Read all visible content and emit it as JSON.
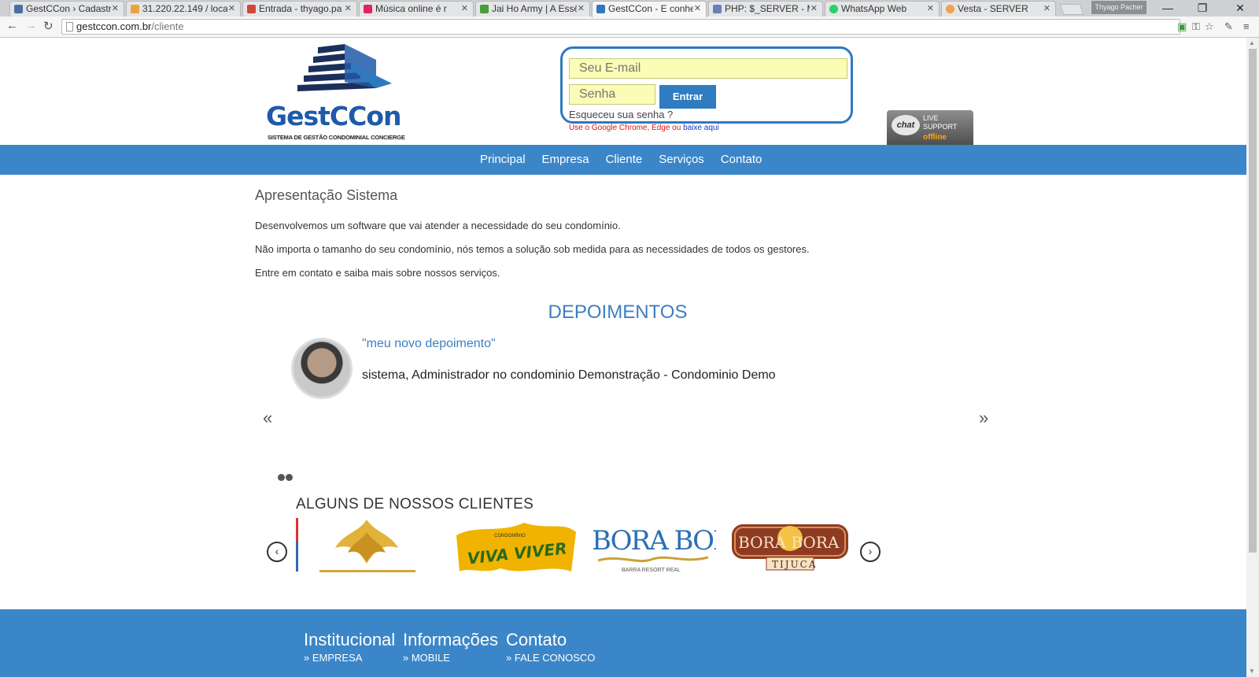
{
  "browser": {
    "tabs": [
      {
        "title": "GestCCon › Cadastr",
        "color": "#4a6fa5"
      },
      {
        "title": "31.220.22.149 / loca",
        "color": "#e8a33d"
      },
      {
        "title": "Entrada - thyago.pa",
        "color": "#d44638"
      },
      {
        "title": "Música online é r",
        "color": "#e0245e"
      },
      {
        "title": "Jai Ho Army | A Essê",
        "color": "#4c9b3a"
      },
      {
        "title": "GestCCon - E conhe",
        "color": "#2f79bf"
      },
      {
        "title": "PHP: $_SERVER - M",
        "color": "#6c7eb7"
      },
      {
        "title": "WhatsApp Web",
        "color": "#25d366"
      },
      {
        "title": "Vesta - SERVER",
        "color": "#f0a050"
      }
    ],
    "active_tab": 5,
    "profile_name": "Thyago Pacher",
    "url_host": "gestccon.com.br",
    "url_path": "/cliente"
  },
  "header": {
    "brand": "GestCCon",
    "tagline": "SISTEMA DE GESTÃO CONDOMINIAL CONCIERGE",
    "email_placeholder": "Seu E-mail",
    "password_placeholder": "Senha",
    "login_button": "Entrar",
    "forgot_link": "Esqueceu sua senha ?",
    "browser_note": "Use o Google Chrome, Edge ou",
    "browser_note_link": "baixe aqui",
    "chat": {
      "bubble": "chat",
      "line1": "LIVE",
      "line2": "SUPPORT",
      "status": "offline"
    }
  },
  "nav": [
    "Principal",
    "Empresa",
    "Cliente",
    "Serviços",
    "Contato"
  ],
  "main": {
    "title": "Apresentação Sistema",
    "paragraphs": [
      "Desenvolvemos um software que vai atender a necessidade do seu condomínio.",
      "Não importa o tamanho do seu condomínio, nós temos a solução sob medida para as necessidades de todos os gestores.",
      "Entre em contato e saiba mais sobre nossos serviços."
    ],
    "testimonials_title": "DEPOIMENTOS",
    "testimonial_quote": "\"meu novo depoimento\"",
    "testimonial_author": "sistema, Administrador no condominio Demonstração - Condominio Demo",
    "prev_arrow": "«",
    "next_arrow": "»",
    "clients_title": "ALGUNS DE NOSSOS CLIENTES",
    "clients": [
      "Viva Viver",
      "Bora Bora",
      "Bora Bora Tijuca"
    ],
    "client_text": {
      "viva_small": "CONDOMÍNIO",
      "viva_big": "VIVA VIVER",
      "bora": "BORA BORA",
      "bora_sub": "BARRA RESORT REAL",
      "tijuca": "TIJUCA"
    }
  },
  "footer": {
    "columns": [
      {
        "head": "Institucional",
        "link": "» EMPRESA"
      },
      {
        "head": "Informações",
        "link": "» MOBILE"
      },
      {
        "head": "Contato",
        "link": "» FALE CONOSCO"
      }
    ]
  }
}
